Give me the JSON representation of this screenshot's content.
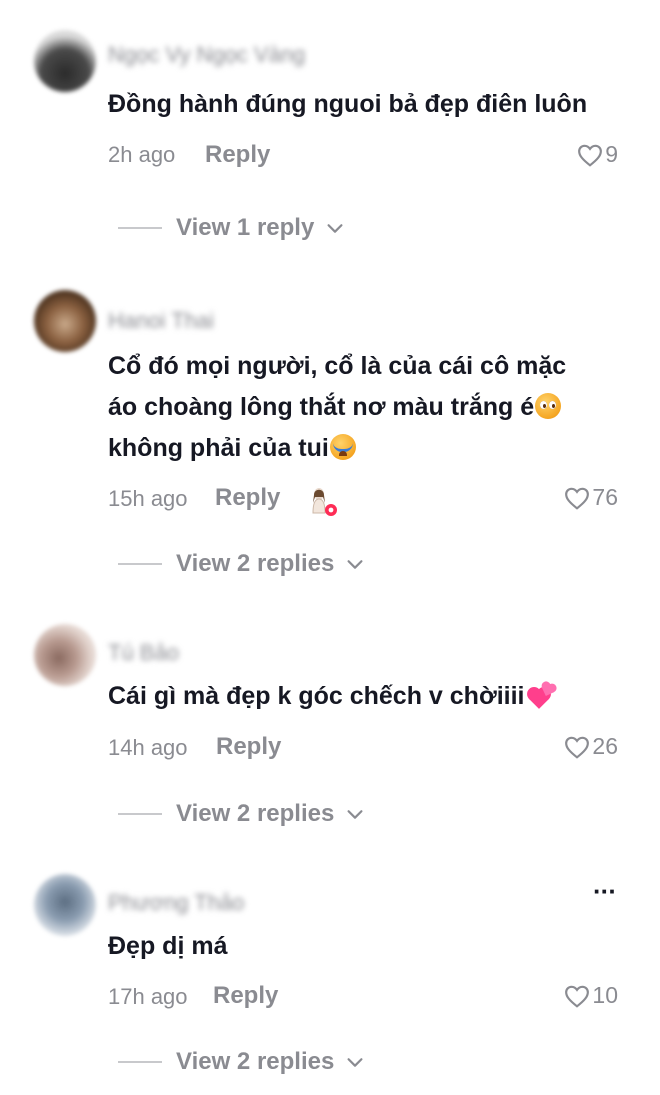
{
  "comments": [
    {
      "username": "Ngọc Vy Ngọc Vàng",
      "text": "Đồng hành đúng nguoi bả đẹp điên luôn",
      "time": "2h ago",
      "reply_label": "Reply",
      "likes": "9",
      "view_replies": "View 1 reply",
      "avatar_colors": [
        "#3a3a3a",
        "#d9d9d9"
      ]
    },
    {
      "username": "Hanoi Thai",
      "text_line1": "Cổ đó mọi người, cổ là của cái cô mặc",
      "text_line2": "áo choàng lông thắt nơ màu trắng é",
      "text_line3": "không phải của tui",
      "emoji_1": "pleading-face-icon",
      "emoji_2": "crying-face-icon",
      "time": "15h ago",
      "reply_label": "Reply",
      "likes": "76",
      "view_replies": "View 2 replies",
      "avatar_colors": [
        "#6b4a2e",
        "#c9a98a"
      ]
    },
    {
      "username": "Tú Bảo",
      "text": "Cái gì mà đẹp k góc chếch v chờiiii",
      "emoji": "two-hearts-icon",
      "time": "14h ago",
      "reply_label": "Reply",
      "likes": "26",
      "view_replies": "View 2 replies",
      "avatar_colors": [
        "#b89a90",
        "#efe4e0"
      ]
    },
    {
      "username": "Phương Thảo",
      "text": "Đẹp dị má",
      "time": "17h ago",
      "reply_label": "Reply",
      "likes": "10",
      "view_replies": "View 2 replies",
      "more_label": "···",
      "avatar_colors": [
        "#7d8ea0",
        "#dfe3e8"
      ]
    }
  ],
  "colors": {
    "text_primary": "#161823",
    "text_secondary": "#8a8b91",
    "divider": "#c8c9cc",
    "creator_badge": "#fe2c55"
  }
}
